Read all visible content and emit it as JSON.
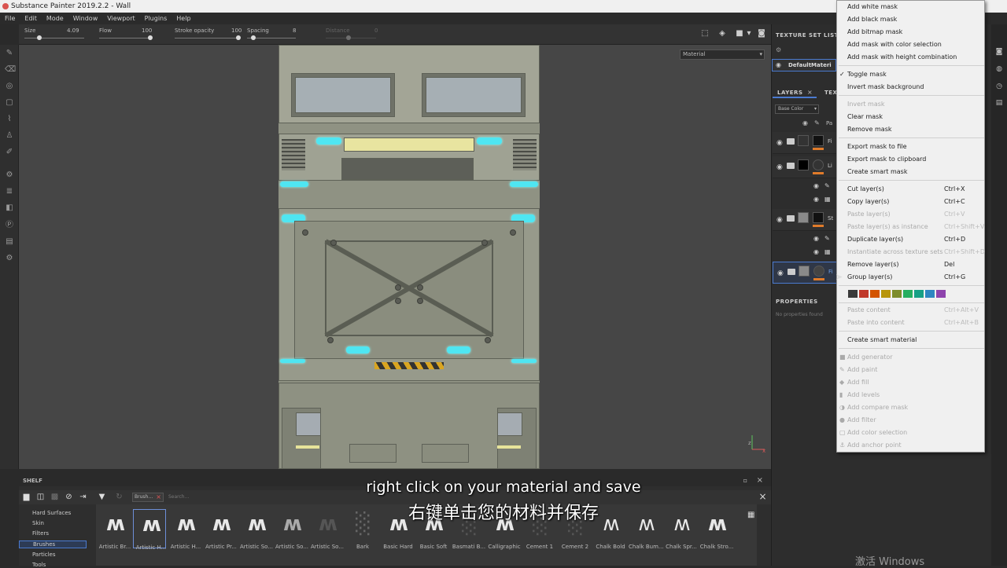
{
  "window": {
    "title": "Substance Painter 2019.2.2 - Wall"
  },
  "menu": [
    "File",
    "Edit",
    "Mode",
    "Window",
    "Viewport",
    "Plugins",
    "Help"
  ],
  "toolbar": {
    "size_label": "Size",
    "size_value": "4.09",
    "flow_label": "Flow",
    "flow_value": "100",
    "opacity_label": "Stroke opacity",
    "opacity_value": "100",
    "spacing_label": "Spacing",
    "spacing_value": "8",
    "distance_label": "Distance",
    "distance_value": "0"
  },
  "viewport": {
    "material_dropdown": "Material"
  },
  "texture_set": {
    "header": "TEXTURE SET LIST",
    "item": "DefaultMateri"
  },
  "layers": {
    "tab_layers": "LAYERS",
    "tab_other": "TEX",
    "channel_dropdown": "Base Color",
    "top_label": "Pa",
    "rows": [
      "Fi",
      "Li",
      "St",
      "Fi"
    ]
  },
  "properties": {
    "header": "PROPERTIES",
    "empty_text": "No properties found"
  },
  "context_menu": {
    "items_mask": [
      "Add white mask",
      "Add black mask",
      "Add bitmap mask",
      "Add mask with color selection",
      "Add mask with height combination"
    ],
    "toggle_mask": "Toggle mask",
    "invert_mask_background": "Invert mask background",
    "invert_mask": "Invert mask",
    "clear_mask": "Clear mask",
    "remove_mask": "Remove mask",
    "export_mask_file": "Export mask to file",
    "export_mask_clipboard": "Export mask to clipboard",
    "create_smart_mask": "Create smart mask",
    "cut": "Cut layer(s)",
    "cut_sc": "Ctrl+X",
    "copy": "Copy layer(s)",
    "copy_sc": "Ctrl+C",
    "paste": "Paste layer(s)",
    "paste_sc": "Ctrl+V",
    "paste_instance": "Paste layer(s) as instance",
    "paste_instance_sc": "Ctrl+Shift+V",
    "duplicate": "Duplicate layer(s)",
    "duplicate_sc": "Ctrl+D",
    "instantiate": "Instantiate across texture sets",
    "instantiate_sc": "Ctrl+Shift+D",
    "remove": "Remove layer(s)",
    "remove_sc": "Del",
    "group": "Group layer(s)",
    "group_sc": "Ctrl+G",
    "paste_content": "Paste content",
    "paste_content_sc": "Ctrl+Alt+V",
    "paste_content_2": "Paste into content",
    "paste_content_2_sc": "Ctrl+Alt+B",
    "create_smart_material": "Create smart material",
    "add_generator": "Add generator",
    "add_paint": "Add paint",
    "add_fill": "Add fill",
    "add_levels": "Add levels",
    "add_compare_mask": "Add compare mask",
    "add_filter": "Add filter",
    "add_color_selection": "Add color selection",
    "add_anchor_point": "Add anchor point",
    "swatches": [
      "#3a3a3a",
      "#c0392b",
      "#d35400",
      "#b7950b",
      "#7d8c2a",
      "#27ae60",
      "#16a085",
      "#2e86c1",
      "#8e44ad"
    ]
  },
  "shelf": {
    "header": "SHELF",
    "brush_tag": "Brush…",
    "search_placeholder": "Search...",
    "categories": [
      "Hard Surfaces",
      "Skin",
      "Filters",
      "Brushes",
      "Particles",
      "Tools"
    ],
    "brushes": [
      "Artistic Br...",
      "Artistic H...",
      "Artistic H...",
      "Artistic Pr...",
      "Artistic So...",
      "Artistic So...",
      "Artistic So...",
      "Bark",
      "Basic Hard",
      "Basic Soft",
      "Basmati B...",
      "Calligraphic",
      "Cement 1",
      "Cement 2",
      "Chalk Bold",
      "Chalk Bum...",
      "Chalk Spr...",
      "Chalk Stro..."
    ]
  },
  "subtitles": {
    "en": "right click on your material and save",
    "zh": "右键单击您的材料并保存"
  },
  "watermark": "激活 Windows"
}
